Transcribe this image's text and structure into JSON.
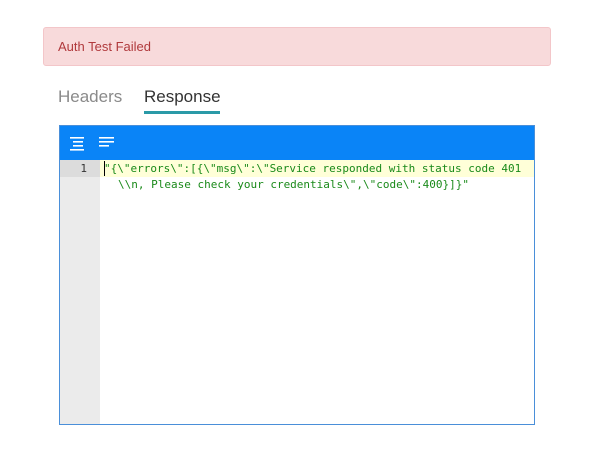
{
  "alert": {
    "message": "Auth Test Failed"
  },
  "tabs": [
    {
      "label": "Headers",
      "active": false
    },
    {
      "label": "Response",
      "active": true
    }
  ],
  "editor": {
    "toolbar": {
      "icons": [
        "format-icon",
        "compact-icon"
      ]
    },
    "lines": [
      {
        "number": "1",
        "text": "\"{\\\"errors\\\":[{\\\"msg\\\":\\\"Service responded with status code 401\\\\n, Please check your credentials\\\",\\\"code\\\":400}]}\""
      }
    ]
  },
  "colors": {
    "alert_background": "#f8dadb",
    "alert_text": "#b0393c",
    "tab_underline": "#2a9aa7",
    "toolbar": "#0a84f7",
    "code_string": "#1a8a1a",
    "active_line": "#ffffd8"
  }
}
